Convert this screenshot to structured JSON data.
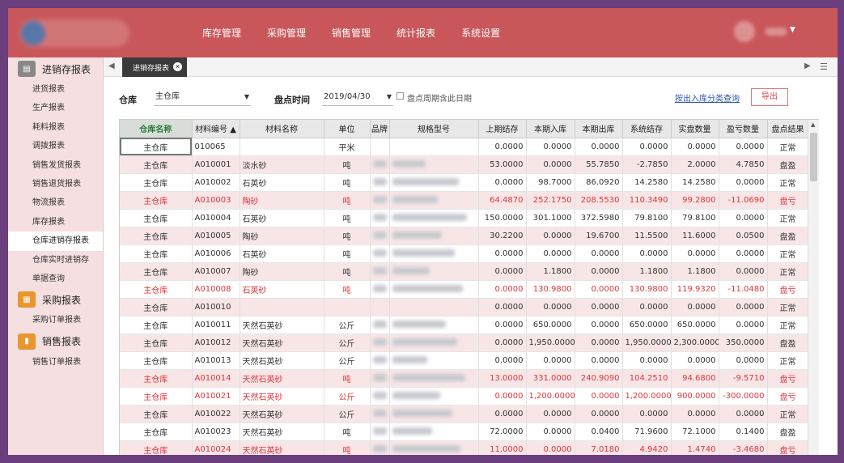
{
  "header": {
    "nav": [
      "库存管理",
      "采购管理",
      "销售管理",
      "统计报表",
      "系统设置"
    ],
    "brand_color": "#c9575a"
  },
  "sidebar": {
    "groups": [
      {
        "title": "进销存报表",
        "icon": "report-icon",
        "color": "#888888",
        "items": [
          "进货报表",
          "生产报表",
          "耗料报表",
          "调拨报表",
          "销售发货报表",
          "销售退货报表",
          "物流报表",
          "库存报表",
          "仓库进销存报表",
          "仓库实时进销存",
          "单据查询"
        ]
      },
      {
        "title": "采购报表",
        "icon": "purchase-icon",
        "color": "#e8962e",
        "items": [
          "采购订单报表"
        ]
      },
      {
        "title": "销售报表",
        "icon": "sales-chart-icon",
        "color": "#e8962e",
        "items": [
          "销售订单报表"
        ]
      }
    ],
    "active_item": "仓库进销存报表"
  },
  "tabs": {
    "active": "进销存报表"
  },
  "filters": {
    "warehouse_label": "仓库",
    "warehouse_value": "主仓库",
    "date_label": "盘点时间",
    "date_value": "2019/04/30",
    "checkbox_label": "盘点周期含此日期",
    "link_label": "按出入库分类查询",
    "export_label": "导出"
  },
  "table": {
    "columns": [
      "仓库名称",
      "材料编号 ▲",
      "材料名称",
      "单位",
      "品牌",
      "规格型号",
      "上期结存",
      "本期入库",
      "本期出库",
      "系统结存",
      "实盘数量",
      "盈亏数量",
      "盘点结果"
    ],
    "rows": [
      {
        "wh": "主仓库",
        "code": "010065",
        "name": "",
        "unit": "平米",
        "prev": "0.0000",
        "in": "0.0000",
        "out": "0.0000",
        "sys": "0.0000",
        "real": "0.0000",
        "diff": "0.0000",
        "result": "正常",
        "red": false
      },
      {
        "wh": "主仓库",
        "code": "A010001",
        "name": "淡水砂",
        "unit": "吨",
        "prev": "53.0000",
        "in": "0.0000",
        "out": "55.7850",
        "sys": "-2.7850",
        "real": "2.0000",
        "diff": "4.7850",
        "result": "盘盈",
        "red": false
      },
      {
        "wh": "主仓库",
        "code": "A010002",
        "name": "石英砂",
        "unit": "吨",
        "prev": "0.0000",
        "in": "98.7000",
        "out": "86.0920",
        "sys": "14.2580",
        "real": "14.2580",
        "diff": "0.0000",
        "result": "正常",
        "red": false
      },
      {
        "wh": "主仓库",
        "code": "A010003",
        "name": "陶砂",
        "unit": "吨",
        "prev": "64.4870",
        "in": "252.1750",
        "out": "208.5530",
        "sys": "110.3490",
        "real": "99.2800",
        "diff": "-11.0690",
        "result": "盘亏",
        "red": true
      },
      {
        "wh": "主仓库",
        "code": "A010004",
        "name": "石英砂",
        "unit": "吨",
        "prev": "150.0000",
        "in": "301.1000",
        "out": "372.5980",
        "sys": "79.8100",
        "real": "79.8100",
        "diff": "0.0000",
        "result": "正常",
        "red": false
      },
      {
        "wh": "主仓库",
        "code": "A010005",
        "name": "陶砂",
        "unit": "吨",
        "prev": "30.2200",
        "in": "0.0000",
        "out": "19.6700",
        "sys": "11.5500",
        "real": "11.6000",
        "diff": "0.0500",
        "result": "盘盈",
        "red": false
      },
      {
        "wh": "主仓库",
        "code": "A010006",
        "name": "石英砂",
        "unit": "吨",
        "prev": "0.0000",
        "in": "0.0000",
        "out": "0.0000",
        "sys": "0.0000",
        "real": "0.0000",
        "diff": "0.0000",
        "result": "正常",
        "red": false
      },
      {
        "wh": "主仓库",
        "code": "A010007",
        "name": "陶砂",
        "unit": "吨",
        "prev": "0.0000",
        "in": "1.1800",
        "out": "0.0000",
        "sys": "1.1800",
        "real": "1.1800",
        "diff": "0.0000",
        "result": "正常",
        "red": false
      },
      {
        "wh": "主仓库",
        "code": "A010008",
        "name": "石英砂",
        "unit": "吨",
        "prev": "0.0000",
        "in": "130.9800",
        "out": "0.0000",
        "sys": "130.9800",
        "real": "119.9320",
        "diff": "-11.0480",
        "result": "盘亏",
        "red": true
      },
      {
        "wh": "主仓库",
        "code": "A010010",
        "name": "",
        "unit": "",
        "prev": "0.0000",
        "in": "0.0000",
        "out": "0.0000",
        "sys": "0.0000",
        "real": "0.0000",
        "diff": "0.0000",
        "result": "正常",
        "red": false
      },
      {
        "wh": "主仓库",
        "code": "A010011",
        "name": "天然石英砂",
        "unit": "公斤",
        "prev": "0.0000",
        "in": "650.0000",
        "out": "0.0000",
        "sys": "650.0000",
        "real": "650.0000",
        "diff": "0.0000",
        "result": "正常",
        "red": false
      },
      {
        "wh": "主仓库",
        "code": "A010012",
        "name": "天然石英砂",
        "unit": "公斤",
        "prev": "0.0000",
        "in": "1,950.0000",
        "out": "0.0000",
        "sys": "1,950.0000",
        "real": "2,300.0000",
        "diff": "350.0000",
        "result": "盘盈",
        "red": false
      },
      {
        "wh": "主仓库",
        "code": "A010013",
        "name": "天然石英砂",
        "unit": "公斤",
        "prev": "0.0000",
        "in": "0.0000",
        "out": "0.0000",
        "sys": "0.0000",
        "real": "0.0000",
        "diff": "0.0000",
        "result": "正常",
        "red": false
      },
      {
        "wh": "主仓库",
        "code": "A010014",
        "name": "天然石英砂",
        "unit": "吨",
        "prev": "13.0000",
        "in": "331.0000",
        "out": "240.9090",
        "sys": "104.2510",
        "real": "94.6800",
        "diff": "-9.5710",
        "result": "盘亏",
        "red": true
      },
      {
        "wh": "主仓库",
        "code": "A010021",
        "name": "天然石英砂",
        "unit": "公斤",
        "prev": "0.0000",
        "in": "1,200.0000",
        "out": "0.0000",
        "sys": "1,200.0000",
        "real": "900.0000",
        "diff": "-300.0000",
        "result": "盘亏",
        "red": true
      },
      {
        "wh": "主仓库",
        "code": "A010022",
        "name": "天然石英砂",
        "unit": "公斤",
        "prev": "0.0000",
        "in": "0.0000",
        "out": "0.0000",
        "sys": "0.0000",
        "real": "0.0000",
        "diff": "0.0000",
        "result": "正常",
        "red": false
      },
      {
        "wh": "主仓库",
        "code": "A010023",
        "name": "天然石英砂",
        "unit": "吨",
        "prev": "72.0000",
        "in": "0.0000",
        "out": "0.0400",
        "sys": "71.9600",
        "real": "72.1000",
        "diff": "0.1400",
        "result": "盘盈",
        "red": false
      },
      {
        "wh": "主仓库",
        "code": "A010024",
        "name": "天然石英砂",
        "unit": "吨",
        "prev": "11.0000",
        "in": "0.0000",
        "out": "7.0180",
        "sys": "4.9420",
        "real": "1.4740",
        "diff": "-3.4680",
        "result": "盘亏",
        "red": true
      }
    ]
  }
}
